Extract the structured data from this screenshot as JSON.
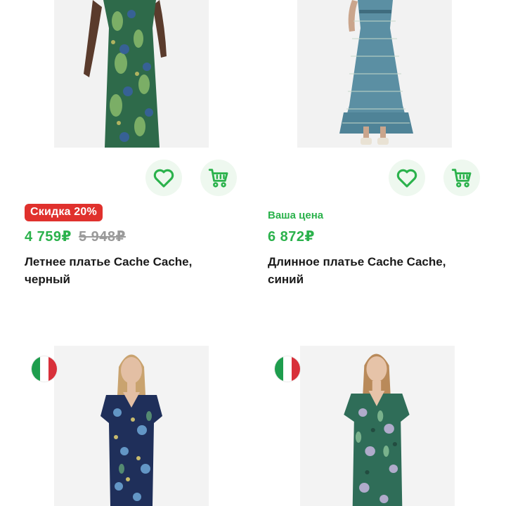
{
  "products": [
    {
      "badge": "Скидка 20%",
      "price_now": "4 759₽",
      "price_old": "5 948₽",
      "title": "Летнее платье Cache Cache, черный"
    },
    {
      "price_label": "Ваша цена",
      "price_now": "6 872₽",
      "title": "Длинное платье Cache Cache, синий"
    },
    {
      "flag": "italy-flag"
    },
    {
      "flag": "italy-flag"
    }
  ],
  "colors": {
    "accent_green": "#2bb24c",
    "badge_red": "#e0312d",
    "old_price_gray": "#9a9a9a",
    "action_bg": "#eef8ef",
    "flag_green": "#1e9d4d",
    "flag_white": "#ffffff",
    "flag_red": "#d8303a"
  },
  "icons": {
    "favorite": "heart-icon",
    "cart": "cart-icon"
  }
}
